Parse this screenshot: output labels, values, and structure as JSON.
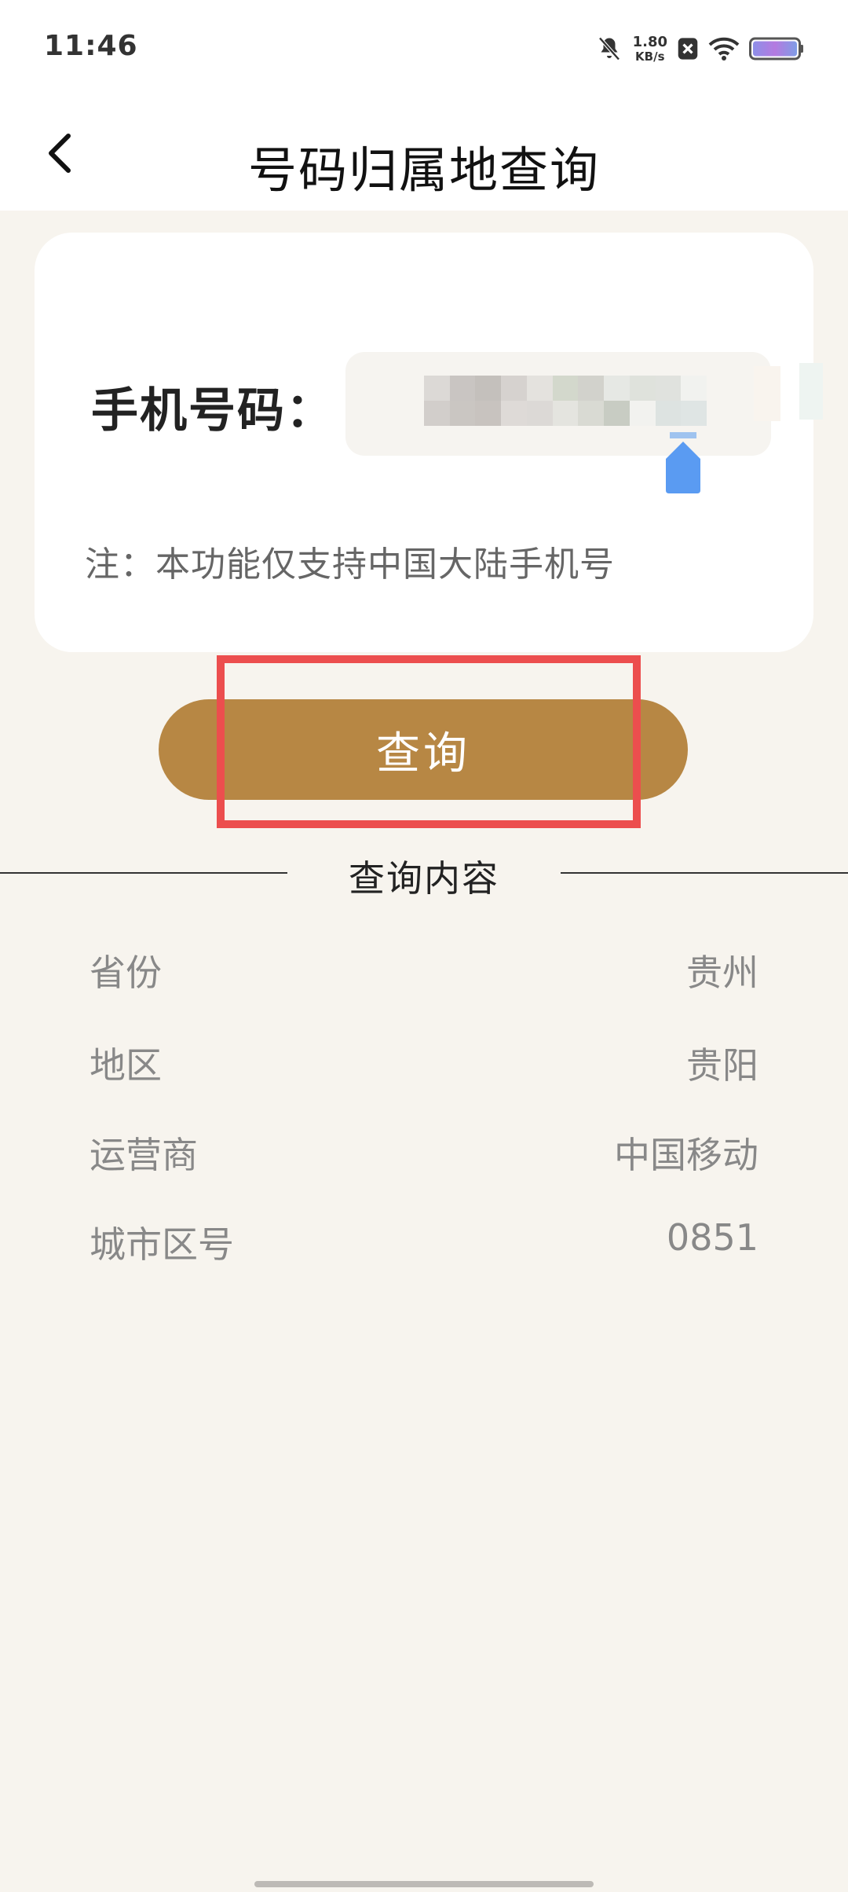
{
  "status_bar": {
    "time": "11:46",
    "net_speed_value": "1.80",
    "net_speed_unit": "KB/s",
    "icons": [
      "mute-bell-icon",
      "sim-disabled-icon",
      "wifi-icon",
      "battery-icon"
    ]
  },
  "header": {
    "title": "号码归属地查询",
    "back_icon": "chevron-left-icon"
  },
  "input_card": {
    "phone_label": "手机号码：",
    "phone_value": "",
    "note": "注：本功能仅支持中国大陆手机号"
  },
  "query_button": {
    "label": "查询",
    "highlight_color": "#ec4e4e",
    "button_color": "#b78744"
  },
  "results": {
    "section_title": "查询内容",
    "rows": [
      {
        "label": "省份",
        "value": "贵州"
      },
      {
        "label": "地区",
        "value": "贵阳"
      },
      {
        "label": "运营商",
        "value": "中国移动"
      },
      {
        "label": "城市区号",
        "value": "0851"
      }
    ]
  },
  "colors": {
    "background": "#f7f4ee",
    "card": "#ffffff",
    "accent": "#b78744",
    "cursor": "#5a9bf2"
  }
}
